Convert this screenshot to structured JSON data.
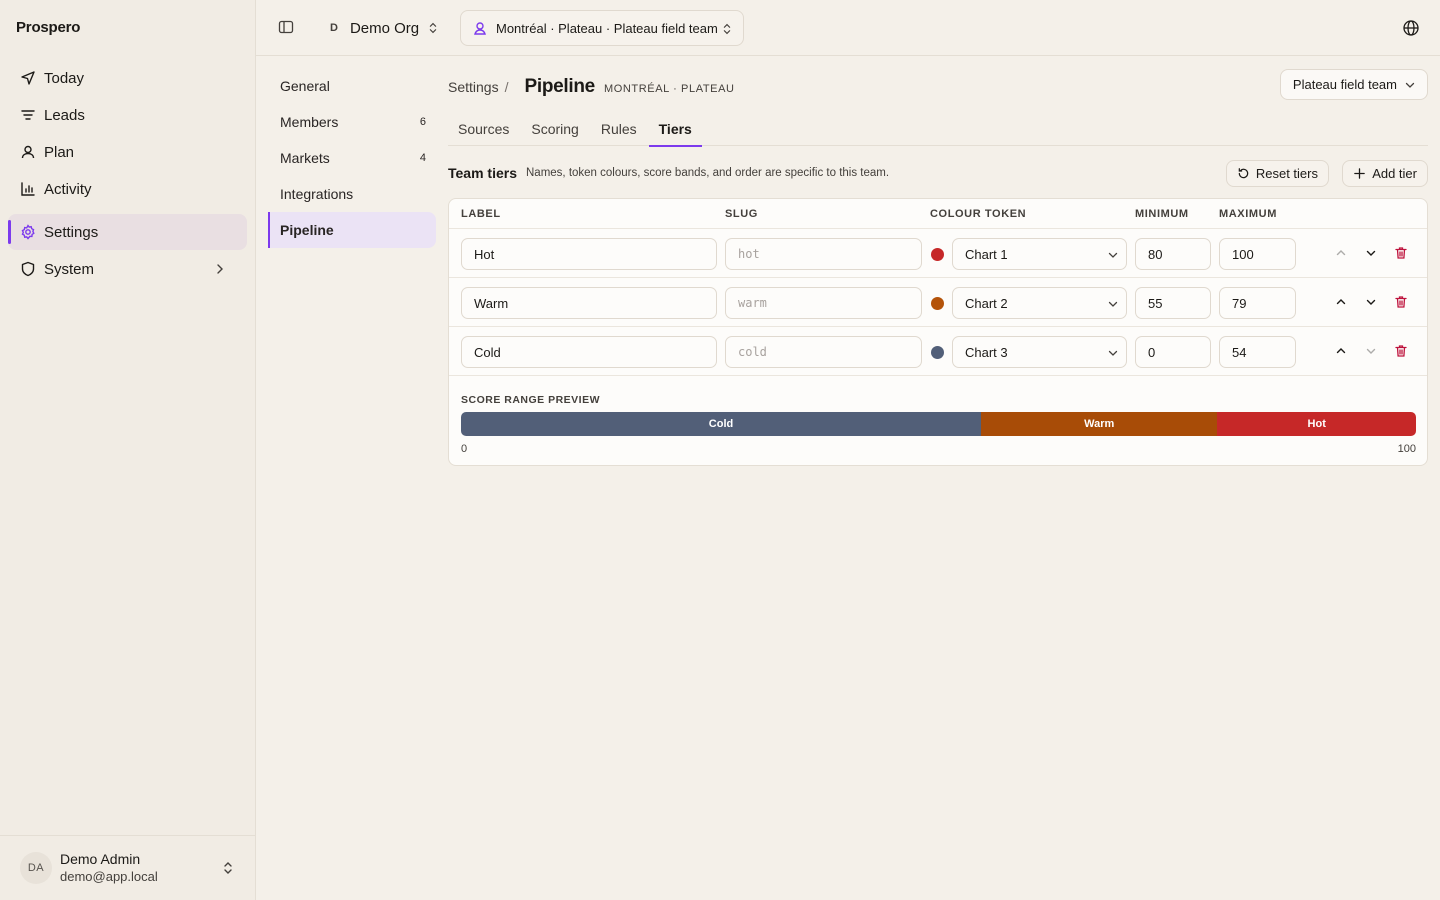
{
  "sidebar": {
    "brand": "Prospero",
    "items": [
      {
        "label": "Today",
        "icon": "send-icon"
      },
      {
        "label": "Leads",
        "icon": "list-icon"
      },
      {
        "label": "Plan",
        "icon": "user-icon"
      },
      {
        "label": "Activity",
        "icon": "bar-chart-icon"
      },
      {
        "label": "Settings",
        "icon": "gear-icon",
        "active": true
      },
      {
        "label": "System",
        "icon": "shield-icon"
      }
    ],
    "user": {
      "initials": "DA",
      "name": "Demo Admin",
      "email": "demo@app.local"
    }
  },
  "topbar": {
    "org_initial": "D",
    "org_name": "Demo Org",
    "scope": "Montréal · Plateau · Plateau field team"
  },
  "subnav": {
    "items": [
      {
        "label": "General",
        "count": ""
      },
      {
        "label": "Members",
        "count": "6"
      },
      {
        "label": "Markets",
        "count": "4"
      },
      {
        "label": "Integrations",
        "count": ""
      },
      {
        "label": "Pipeline",
        "count": "",
        "active": true
      }
    ]
  },
  "main": {
    "breadcrumb_root": "Settings",
    "breadcrumb_sep": "/",
    "title": "Pipeline",
    "subtitle": "MONTRÉAL · PLATEAU",
    "team_select": "Plateau field team",
    "tabs": [
      "Sources",
      "Scoring",
      "Rules",
      "Tiers"
    ],
    "active_tab": "Tiers",
    "section_title": "Team tiers",
    "section_desc": "Names, token colours, score bands, and order are specific to this team.",
    "reset_label": "Reset tiers",
    "add_label": "Add tier",
    "columns": [
      "LABEL",
      "SLUG",
      "COLOUR TOKEN",
      "MINIMUM",
      "MAXIMUM"
    ],
    "tiers": [
      {
        "label": "Hot",
        "slug": "hot",
        "color": "#c62828",
        "token": "Chart 1",
        "min": "80",
        "max": "100"
      },
      {
        "label": "Warm",
        "slug": "warm",
        "color": "#b45309",
        "token": "Chart 2",
        "min": "55",
        "max": "79"
      },
      {
        "label": "Cold",
        "slug": "cold",
        "color": "#525f78",
        "token": "Chart 3",
        "min": "0",
        "max": "54"
      }
    ],
    "preview_label": "SCORE RANGE PREVIEW",
    "preview_segments": [
      {
        "label": "Cold",
        "from": 0,
        "to": 54,
        "color": "#525f78"
      },
      {
        "label": "Warm",
        "from": 55,
        "to": 79,
        "color": "#a84c07"
      },
      {
        "label": "Hot",
        "from": 80,
        "to": 100,
        "color": "#c62828"
      }
    ],
    "axis_min": "0",
    "axis_max": "100"
  },
  "colors": {
    "accent": "#7c3aed",
    "danger": "#be123c"
  }
}
